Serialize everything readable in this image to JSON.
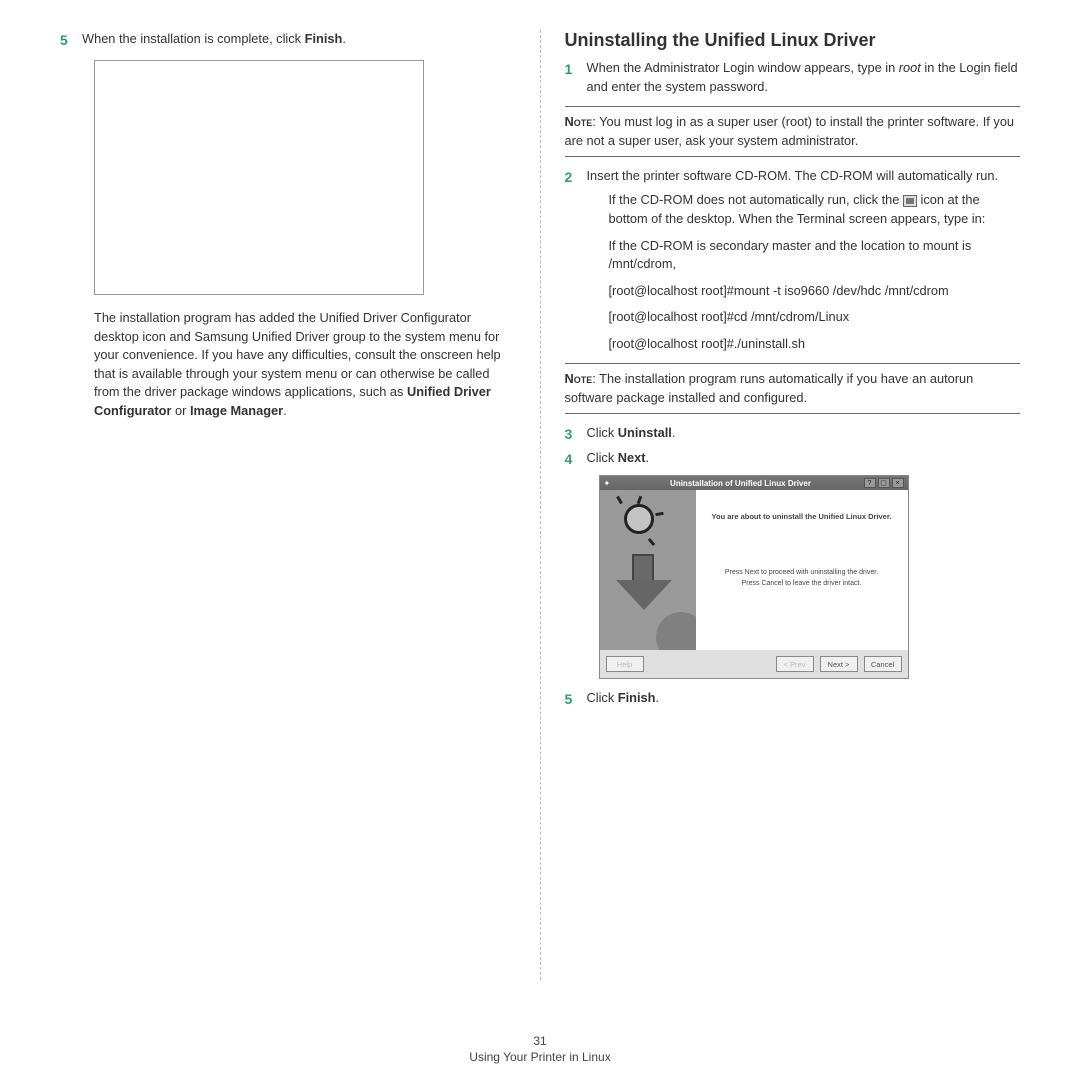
{
  "left": {
    "step5_num": "5",
    "step5_prefix": "When the installation is complete, click ",
    "step5_bold": "Finish",
    "step5_suffix": ".",
    "desc_prefix": "The installation program has added the Unified Driver Configurator desktop icon and Samsung Unified Driver group to the system menu for your convenience. If you have any difficulties, consult the onscreen help that is available through your system menu or can otherwise be called from the driver package windows applications, such as ",
    "desc_bold1": "Unified Driver Configurator",
    "desc_mid": " or ",
    "desc_bold2": "Image Manager",
    "desc_suffix": "."
  },
  "right": {
    "title": "Uninstalling the Unified Linux Driver",
    "s1_num": "1",
    "s1_a": "When the Administrator Login window appears, type in ",
    "s1_root": "root",
    "s1_b": " in the Login field and enter the system password.",
    "note1_label": "Note",
    "note1_body": ": You must log in as a super user (root) to install the printer software. If you are not a super user, ask your system administrator.",
    "s2_num": "2",
    "s2_body": "Insert the printer software CD-ROM. The CD-ROM will automatically run.",
    "s2_sub1_a": "If the CD-ROM does not automatically run, click the ",
    "s2_sub1_b": " icon at the bottom of the desktop. When the Terminal screen appears, type in:",
    "s2_sub2": "If the CD-ROM is secondary master and the location to mount is /mnt/cdrom,",
    "s2_sub3": "[root@localhost root]#mount -t iso9660 /dev/hdc /mnt/cdrom",
    "s2_sub4": "[root@localhost root]#cd /mnt/cdrom/Linux",
    "s2_sub5": "[root@localhost root]#./uninstall.sh",
    "note2_label": "Note",
    "note2_body": ": The installation program runs automatically if you have an autorun software package installed and configured.",
    "s3_num": "3",
    "s3_a": "Click ",
    "s3_bold": "Uninstall",
    "s3_b": ".",
    "s4_num": "4",
    "s4_a": "Click ",
    "s4_bold": "Next",
    "s4_b": ".",
    "dialog": {
      "title": "Uninstallation of Unified Linux Driver",
      "msg1": "You are about to uninstall the Unified Linux Driver.",
      "msg2": "Press Next to proceed with uninstalling the driver.",
      "msg3": "Press Cancel to leave the driver intact.",
      "help": "Help",
      "prev": "< Prev",
      "next": "Next >",
      "cancel": "Cancel"
    },
    "s5_num": "5",
    "s5_a": "Click ",
    "s5_bold": "Finish",
    "s5_b": "."
  },
  "footer": {
    "page": "31",
    "section": "Using Your Printer in Linux"
  }
}
